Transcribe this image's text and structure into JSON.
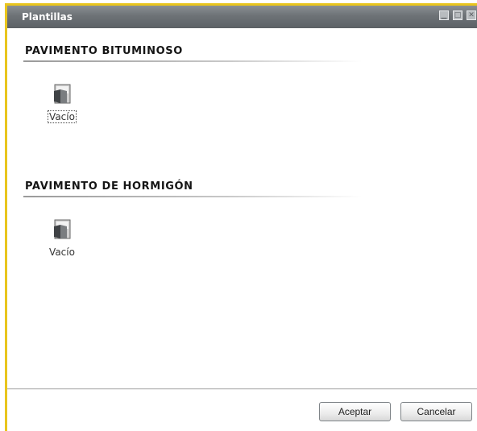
{
  "window": {
    "title": "Plantillas",
    "controls": [
      "minimize",
      "maximize",
      "close"
    ]
  },
  "sections": [
    {
      "header": "PAVIMENTO BITUMINOSO",
      "items": [
        {
          "label": "Vacío",
          "icon": "blank-template-icon",
          "selected": true
        }
      ]
    },
    {
      "header": "PAVIMENTO DE HORMIGÓN",
      "items": [
        {
          "label": "Vacío",
          "icon": "blank-template-icon",
          "selected": false
        }
      ]
    }
  ],
  "buttons": {
    "accept": "Aceptar",
    "cancel": "Cancelar"
  },
  "colors": {
    "frame": "#e9c51d",
    "titlebar": "#6d7276"
  }
}
